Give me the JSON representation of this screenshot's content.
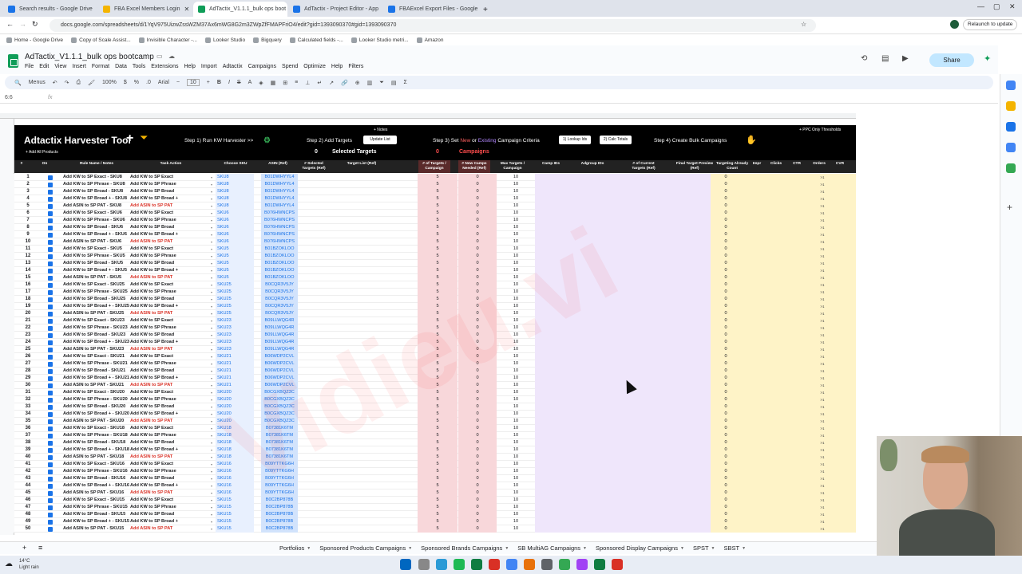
{
  "browser": {
    "tabs": [
      {
        "label": "Search results - Google Drive",
        "color": "#1a73e8",
        "active": false
      },
      {
        "label": "FBA Excel Members Login",
        "color": "#f4b400",
        "active": false
      },
      {
        "label": "AdTactix_V1.1.1_bulk ops boot",
        "color": "#0f9d58",
        "active": true
      },
      {
        "label": "AdTactix - Project Editor - App",
        "color": "#1a73e8",
        "active": false
      },
      {
        "label": "FBAExcel Export Files - Google",
        "color": "#1a73e8",
        "active": false
      }
    ],
    "url": "docs.google.com/spreadsheets/d/1YqV975UizwZssWZM37Ax6mWG8G2m3ZWpZfFMAPFriO4/edit?gid=1393090370#gid=1393090370",
    "relaunch": "Relaunch to update",
    "bookmarks": [
      "Home - Google Drive",
      "Copy of Scale Assist...",
      "Invisible Character -...",
      "Looker Studio",
      "Bigquery",
      "Calculated fields -...",
      "Looker Studio metri...",
      "Amazon"
    ]
  },
  "doc": {
    "title": "AdTactix_V1.1.1_bulk ops bootcamp",
    "menu": [
      "File",
      "Edit",
      "View",
      "Insert",
      "Format",
      "Data",
      "Tools",
      "Extensions",
      "Help",
      "Import",
      "Adtactix",
      "Campaigns",
      "Spend",
      "Optimize",
      "Help",
      "Filters"
    ],
    "share_label": "Share",
    "toolbar": {
      "menus": "Menus",
      "zoom": "100%",
      "font": "Arial",
      "font_size": "10"
    },
    "cell_ref": "6:6",
    "fx": "fx"
  },
  "banner": {
    "title": "Adtactix Harvester Tool",
    "add_all": "+ Add All Products",
    "step1": "Step 1) Run KW Harvester >>",
    "notes": "+ Notes",
    "step2": "Step 2) Add Targets",
    "update_list": "Update List",
    "selected_count": "0",
    "selected_label": "Selected Targets",
    "step3_pre": "Step 3) Set",
    "step3_new": "New",
    "step3_or": "or",
    "step3_existing": "Existing",
    "step3_post": "Campaign Criteria",
    "campaigns_count": "0",
    "campaigns_label": "Campaigns",
    "lookup_ids": "1) Lookup Ids",
    "calc_totals": "2) Calc Totals",
    "step4": "Step 4) Create Bulk Campaigns",
    "ppc_only": "+ PPC Only Thresholds"
  },
  "columns": [
    "#",
    "On",
    "Rule Name / Notes",
    "Task Action",
    "Choose SKU",
    "ASIN (Ref)",
    "# Selected Targets (Ref)",
    "Target List (Ref)",
    "# of Targets / Campaign",
    "# New Camps Needed (Ref)",
    "Max Targets / Campaign",
    "Camp IDs",
    "Adgroup IDs",
    "# of Current Targets (Ref)",
    "Final Target Preview (Ref)",
    "Targeting Already Count",
    "Impr",
    "Clicks",
    "CTR",
    "Orders",
    "CVR"
  ],
  "rows": [
    {
      "n": "1",
      "rule": "Add KW to SP Exact - SKU8",
      "task": "Add KW to SP Exact",
      "sku": "SKU8",
      "asin": "B01DWHYYL4"
    },
    {
      "n": "2",
      "rule": "Add KW to SP Phrase - SKU8",
      "task": "Add KW to SP Phrase",
      "sku": "SKU8",
      "asin": "B01DWHYYL4"
    },
    {
      "n": "3",
      "rule": "Add KW to SP Broad - SKU8",
      "task": "Add KW to SP Broad",
      "sku": "SKU8",
      "asin": "B01DWHYYL4"
    },
    {
      "n": "4",
      "rule": "Add KW to SP Broad + - SKU8",
      "task": "Add KW to SP Broad +",
      "sku": "SKU8",
      "asin": "B01DWHYYL4"
    },
    {
      "n": "5",
      "rule": "Add ASIN to SP PAT - SKU8",
      "task": "Add ASIN to SP PAT",
      "sku": "SKU8",
      "asin": "B01DWHYYL4"
    },
    {
      "n": "6",
      "rule": "Add KW to SP Exact - SKU6",
      "task": "Add KW to SP Exact",
      "sku": "SKU6",
      "asin": "B076HWNCPS"
    },
    {
      "n": "7",
      "rule": "Add KW to SP Phrase - SKU6",
      "task": "Add KW to SP Phrase",
      "sku": "SKU6",
      "asin": "B076HWNCPS"
    },
    {
      "n": "8",
      "rule": "Add KW to SP Broad - SKU6",
      "task": "Add KW to SP Broad",
      "sku": "SKU6",
      "asin": "B076HWNCPS"
    },
    {
      "n": "9",
      "rule": "Add KW to SP Broad + - SKU6",
      "task": "Add KW to SP Broad +",
      "sku": "SKU6",
      "asin": "B076HWNCPS"
    },
    {
      "n": "10",
      "rule": "Add ASIN to SP PAT - SKU6",
      "task": "Add ASIN to SP PAT",
      "sku": "SKU6",
      "asin": "B076HWNCPS"
    },
    {
      "n": "11",
      "rule": "Add KW to SP Exact - SKU5",
      "task": "Add KW to SP Exact",
      "sku": "SKU5",
      "asin": "B01BZOKLOO"
    },
    {
      "n": "12",
      "rule": "Add KW to SP Phrase - SKU5",
      "task": "Add KW to SP Phrase",
      "sku": "SKU5",
      "asin": "B01BZOKLOO"
    },
    {
      "n": "13",
      "rule": "Add KW to SP Broad - SKU5",
      "task": "Add KW to SP Broad",
      "sku": "SKU5",
      "asin": "B01BZOKLOO"
    },
    {
      "n": "14",
      "rule": "Add KW to SP Broad + - SKU5",
      "task": "Add KW to SP Broad +",
      "sku": "SKU5",
      "asin": "B01BZOKLOO"
    },
    {
      "n": "15",
      "rule": "Add ASIN to SP PAT - SKU5",
      "task": "Add ASIN to SP PAT",
      "sku": "SKU5",
      "asin": "B01BZOKLOO"
    },
    {
      "n": "16",
      "rule": "Add KW to SP Exact - SKU25",
      "task": "Add KW to SP Exact",
      "sku": "SKU25",
      "asin": "B0CQR3V5JY"
    },
    {
      "n": "17",
      "rule": "Add KW to SP Phrase - SKU25",
      "task": "Add KW to SP Phrase",
      "sku": "SKU25",
      "asin": "B0CQR3V5JY"
    },
    {
      "n": "18",
      "rule": "Add KW to SP Broad - SKU25",
      "task": "Add KW to SP Broad",
      "sku": "SKU25",
      "asin": "B0CQR3V5JY"
    },
    {
      "n": "19",
      "rule": "Add KW to SP Broad + - SKU25",
      "task": "Add KW to SP Broad +",
      "sku": "SKU25",
      "asin": "B0CQR3V5JY"
    },
    {
      "n": "20",
      "rule": "Add ASIN to SP PAT - SKU25",
      "task": "Add ASIN to SP PAT",
      "sku": "SKU25",
      "asin": "B0CQR3V5JY"
    },
    {
      "n": "21",
      "rule": "Add KW to SP Exact - SKU23",
      "task": "Add KW to SP Exact",
      "sku": "SKU23",
      "asin": "B09LLWQG4R"
    },
    {
      "n": "22",
      "rule": "Add KW to SP Phrase - SKU23",
      "task": "Add KW to SP Phrase",
      "sku": "SKU23",
      "asin": "B09LLWQG4R"
    },
    {
      "n": "23",
      "rule": "Add KW to SP Broad - SKU23",
      "task": "Add KW to SP Broad",
      "sku": "SKU23",
      "asin": "B09LLWQG4R"
    },
    {
      "n": "24",
      "rule": "Add KW to SP Broad + - SKU23",
      "task": "Add KW to SP Broad +",
      "sku": "SKU23",
      "asin": "B09LLWQG4R"
    },
    {
      "n": "25",
      "rule": "Add ASIN to SP PAT - SKU23",
      "task": "Add ASIN to SP PAT",
      "sku": "SKU23",
      "asin": "B09LLWQG4R"
    },
    {
      "n": "26",
      "rule": "Add KW to SP Exact - SKU21",
      "task": "Add KW to SP Exact",
      "sku": "SKU21",
      "asin": "B06WDP2CVL"
    },
    {
      "n": "27",
      "rule": "Add KW to SP Phrase - SKU21",
      "task": "Add KW to SP Phrase",
      "sku": "SKU21",
      "asin": "B06WDP2CVL"
    },
    {
      "n": "28",
      "rule": "Add KW to SP Broad - SKU21",
      "task": "Add KW to SP Broad",
      "sku": "SKU21",
      "asin": "B06WDP2CVL"
    },
    {
      "n": "29",
      "rule": "Add KW to SP Broad + - SKU21",
      "task": "Add KW to SP Broad +",
      "sku": "SKU21",
      "asin": "B06WDP2CVL"
    },
    {
      "n": "30",
      "rule": "Add ASIN to SP PAT - SKU21",
      "task": "Add ASIN to SP PAT",
      "sku": "SKU21",
      "asin": "B06WDP2CVL"
    },
    {
      "n": "31",
      "rule": "Add KW to SP Exact - SKU20",
      "task": "Add KW to SP Exact",
      "sku": "SKU20",
      "asin": "B0CGXBQZ3C"
    },
    {
      "n": "32",
      "rule": "Add KW to SP Phrase - SKU20",
      "task": "Add KW to SP Phrase",
      "sku": "SKU20",
      "asin": "B0CGXBQZ3C"
    },
    {
      "n": "33",
      "rule": "Add KW to SP Broad - SKU20",
      "task": "Add KW to SP Broad",
      "sku": "SKU20",
      "asin": "B0CGXBQZ3C"
    },
    {
      "n": "34",
      "rule": "Add KW to SP Broad + - SKU20",
      "task": "Add KW to SP Broad +",
      "sku": "SKU20",
      "asin": "B0CGXBQZ3C"
    },
    {
      "n": "35",
      "rule": "Add ASIN to SP PAT - SKU20",
      "task": "Add ASIN to SP PAT",
      "sku": "SKU20",
      "asin": "B0CGXBQZ3C"
    },
    {
      "n": "36",
      "rule": "Add KW to SP Exact - SKU18",
      "task": "Add KW to SP Exact",
      "sku": "SKU18",
      "asin": "B07381K6TM"
    },
    {
      "n": "37",
      "rule": "Add KW to SP Phrase - SKU18",
      "task": "Add KW to SP Phrase",
      "sku": "SKU18",
      "asin": "B07381K6TM"
    },
    {
      "n": "38",
      "rule": "Add KW to SP Broad - SKU18",
      "task": "Add KW to SP Broad",
      "sku": "SKU18",
      "asin": "B07381K6TM"
    },
    {
      "n": "39",
      "rule": "Add KW to SP Broad + - SKU18",
      "task": "Add KW to SP Broad +",
      "sku": "SKU18",
      "asin": "B07381K6TM"
    },
    {
      "n": "40",
      "rule": "Add ASIN to SP PAT - SKU18",
      "task": "Add ASIN to SP PAT",
      "sku": "SKU18",
      "asin": "B07381K6TM"
    },
    {
      "n": "41",
      "rule": "Add KW to SP Exact - SKU16",
      "task": "Add KW to SP Exact",
      "sku": "SKU16",
      "asin": "B09YTTKG6H"
    },
    {
      "n": "42",
      "rule": "Add KW to SP Phrase - SKU16",
      "task": "Add KW to SP Phrase",
      "sku": "SKU16",
      "asin": "B09YTTKG6H"
    },
    {
      "n": "43",
      "rule": "Add KW to SP Broad - SKU16",
      "task": "Add KW to SP Broad",
      "sku": "SKU16",
      "asin": "B09YTTKG6H"
    },
    {
      "n": "44",
      "rule": "Add KW to SP Broad + - SKU16",
      "task": "Add KW to SP Broad +",
      "sku": "SKU16",
      "asin": "B09YTTKG6H"
    },
    {
      "n": "45",
      "rule": "Add ASIN to SP PAT - SKU16",
      "task": "Add ASIN to SP PAT",
      "sku": "SKU16",
      "asin": "B09YTTKG6H"
    },
    {
      "n": "46",
      "rule": "Add KW to SP Exact - SKU15",
      "task": "Add KW to SP Exact",
      "sku": "SKU15",
      "asin": "B0C2BP878B"
    },
    {
      "n": "47",
      "rule": "Add KW to SP Phrase - SKU15",
      "task": "Add KW to SP Phrase",
      "sku": "SKU15",
      "asin": "B0C2BP878B"
    },
    {
      "n": "48",
      "rule": "Add KW to SP Broad - SKU15",
      "task": "Add KW to SP Broad",
      "sku": "SKU15",
      "asin": "B0C2BP878B"
    },
    {
      "n": "49",
      "rule": "Add KW to SP Broad + - SKU15",
      "task": "Add KW to SP Broad +",
      "sku": "SKU15",
      "asin": "B0C2BP878B"
    },
    {
      "n": "50",
      "rule": "Add ASIN to SP PAT - SKU15",
      "task": "Add ASIN to SP PAT",
      "sku": "SKU15",
      "asin": "B0C2BP878B"
    }
  ],
  "row_values": {
    "targets_per_campaign": "5",
    "new_camps": "0",
    "max_targets": "10",
    "already_count": "0",
    "orders": ">1"
  },
  "sheet_tabs": [
    "Portfolios",
    "Sponsored Products Campaigns",
    "Sponsored Brands Campaigns",
    "SB MultiAG Campaigns",
    "Sponsored Display Campaigns",
    "SPST",
    "SBST"
  ],
  "taskbar": {
    "temp": "14°C",
    "weather": "Light rain"
  }
}
